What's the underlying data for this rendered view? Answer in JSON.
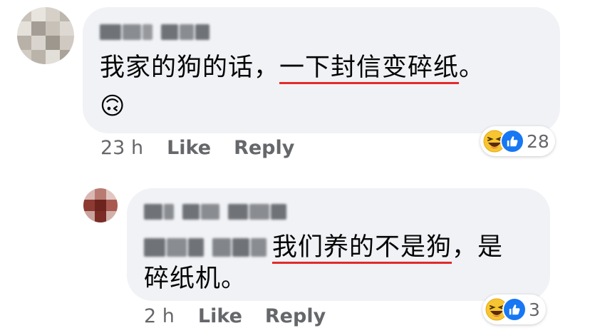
{
  "comments": [
    {
      "text_plain": "我家的狗的话，",
      "text_underlined": "一下封信变碎纸",
      "text_end": "。",
      "emoji": "🙃",
      "time": "23 h",
      "like_label": "Like",
      "reply_label": "Reply",
      "reaction_count": "28",
      "reactions": [
        "laughing-emoji",
        "like-thumb"
      ]
    },
    {
      "text_underlined": "我们养的不是狗",
      "text_rest": "，是",
      "text_line2": "碎纸机。",
      "time": "2 h",
      "like_label": "Like",
      "reply_label": "Reply",
      "reaction_count": "3",
      "reactions": [
        "laughing-emoji",
        "like-thumb"
      ]
    }
  ],
  "colors": {
    "bubble": "#f0f2f5",
    "underline": "#e22a2a",
    "meta": "#65676b",
    "like_blue": "#1877f2"
  }
}
